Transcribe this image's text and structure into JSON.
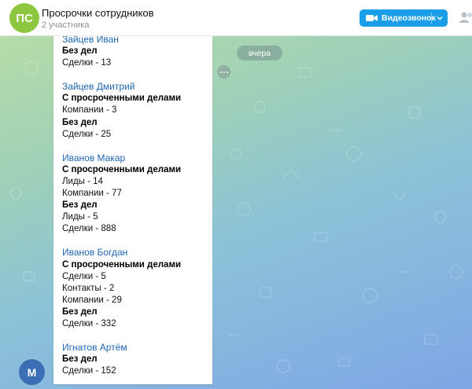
{
  "header": {
    "avatar_initials": "ПС",
    "title": "Просрочки сотрудников",
    "subtitle": "2 участника",
    "video_call_label": "Видеозвонок",
    "icons": [
      "video-camera-icon",
      "chevron-down-icon",
      "users-icon"
    ],
    "colors": {
      "avatar": "#8dc63f",
      "video_button": "#1a9ee8"
    }
  },
  "chat": {
    "date_label": "вчера",
    "sender_avatar_initial": "M",
    "message": {
      "employees": [
        {
          "name": "Зайцев Иван",
          "sections": [
            {
              "heading": "Без дел",
              "lines": [
                "Сделки - 13"
              ]
            }
          ]
        },
        {
          "name": "Зайцев Дмитрий",
          "sections": [
            {
              "heading": "С просроченными делами",
              "lines": [
                "Компании - 3"
              ]
            },
            {
              "heading": "Без дел",
              "lines": [
                "Сделки - 25"
              ]
            }
          ]
        },
        {
          "name": "Иванов Макар",
          "sections": [
            {
              "heading": "С просроченными делами",
              "lines": [
                "Лиды - 14",
                "Компании - 77"
              ]
            },
            {
              "heading": "Без дел",
              "lines": [
                "Лиды - 5",
                "Сделки - 888"
              ]
            }
          ]
        },
        {
          "name": "Иванов Богдан",
          "sections": [
            {
              "heading": "С просроченными делами",
              "lines": [
                "Сделки - 5",
                "Контакты - 2",
                "Компании - 29"
              ]
            },
            {
              "heading": "Без дел",
              "lines": [
                "Сделки - 332"
              ]
            }
          ]
        },
        {
          "name": "Игнатов Артём",
          "sections": [
            {
              "heading": "Без дел",
              "lines": [
                "Сделки - 152"
              ]
            }
          ]
        }
      ]
    }
  }
}
